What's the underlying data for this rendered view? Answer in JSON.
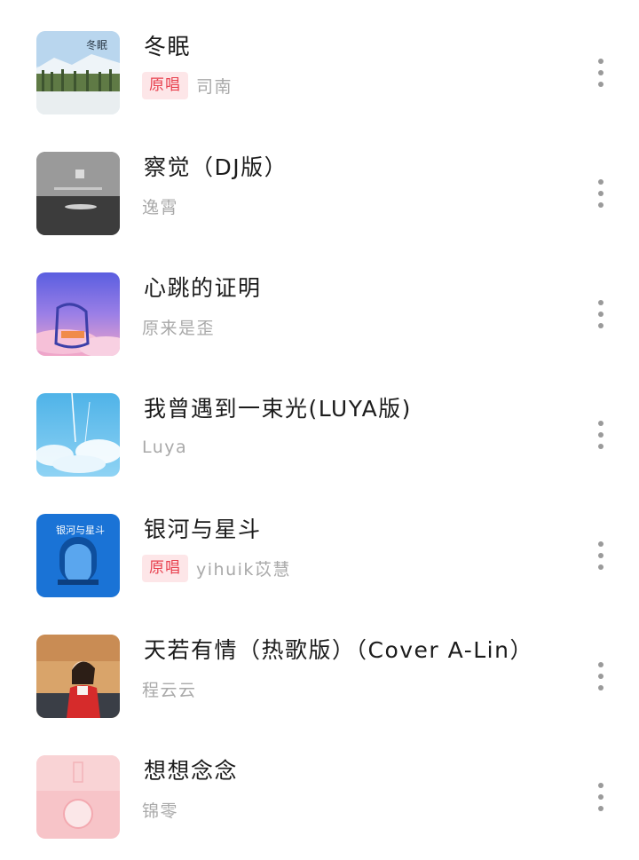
{
  "songs": [
    {
      "title": "冬眠",
      "badge": "原唱",
      "artist": "司南",
      "cover_icon": "album-cover-snowy-field"
    },
    {
      "title": "察觉（DJ版）",
      "badge": "",
      "artist": "逸霄",
      "cover_icon": "album-cover-grey-sea"
    },
    {
      "title": "心跳的证明",
      "badge": "",
      "artist": "原来是歪",
      "cover_icon": "album-cover-purple-sky"
    },
    {
      "title": "我曾遇到一束光(LUYA版)",
      "badge": "",
      "artist": "Luya",
      "cover_icon": "album-cover-blue-clouds"
    },
    {
      "title": "银河与星斗",
      "badge": "原唱",
      "artist": "yihuik苡慧",
      "cover_icon": "album-cover-blue-arch"
    },
    {
      "title": "天若有情（热歌版）（Cover A-Lin）",
      "badge": "",
      "artist": "程云云",
      "cover_icon": "album-cover-girl-portrait"
    },
    {
      "title": "想想念念",
      "badge": "",
      "artist": "锦零",
      "cover_icon": "album-cover-pink-seal"
    }
  ],
  "colors": {
    "badge_text": "#e8404e",
    "badge_bg": "#fde6e8",
    "title_text": "#1c1c1c",
    "artist_text": "#a9a9a9",
    "more_dots": "#9a9a9a"
  }
}
